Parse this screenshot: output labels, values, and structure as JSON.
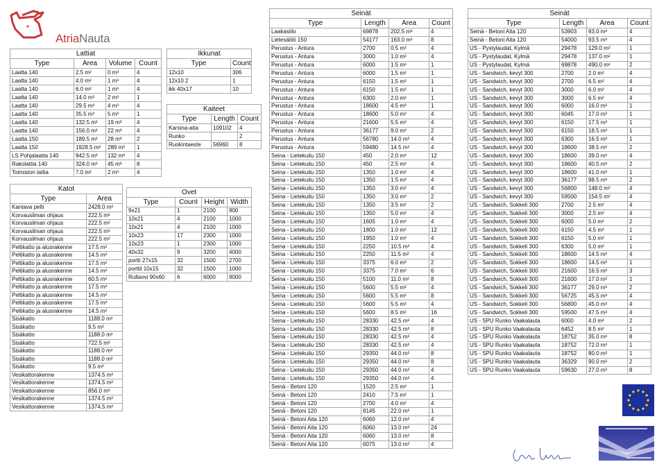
{
  "brand": {
    "name_part1": "Atria",
    "name_part2": "Nauta",
    "accent": "#c8373c",
    "secondary": "#6d6e71"
  },
  "lattiat": {
    "title": "Lattiat",
    "columns": [
      "Type",
      "Area",
      "Volume",
      "Count"
    ],
    "rows": [
      [
        "Laatta 140",
        "2.5 m²",
        "0 m³",
        "4"
      ],
      [
        "Laatta 140",
        "4.0 m²",
        "1 m³",
        "4"
      ],
      [
        "Laatta 140",
        "6.0 m²",
        "1 m³",
        "4"
      ],
      [
        "Laatta 140",
        "14.0 m²",
        "2 m³",
        "1"
      ],
      [
        "Laatta 140",
        "29.5 m²",
        "4 m³",
        "4"
      ],
      [
        "Laatta 140",
        "35.5 m²",
        "5 m³",
        "1"
      ],
      [
        "Laatta 140",
        "132.5 m²",
        "19 m³",
        "4"
      ],
      [
        "Laatta 140",
        "156.0 m²",
        "22 m³",
        "4"
      ],
      [
        "Laatta 150",
        "189.5 m²",
        "28 m³",
        "2"
      ],
      [
        "Laatta 150",
        "1928.5 m²",
        "289 m³",
        "1"
      ],
      [
        "LS Pohjalaatta 140",
        "942.5 m²",
        "132 m³",
        "4"
      ],
      [
        "Rakolattia 140",
        "324.0 m²",
        "45 m³",
        "8"
      ],
      [
        "Toimiston lattia",
        "7.0 m²",
        "2 m³",
        "4"
      ]
    ]
  },
  "ikkunat": {
    "title": "Ikkunat",
    "columns": [
      "Type",
      "Count"
    ],
    "rows": [
      [
        "12x10",
        "306"
      ],
      [
        "12x10 2",
        "1"
      ],
      [
        "ikk 40x17",
        "10"
      ]
    ]
  },
  "kaiteet": {
    "title": "Kaiteet",
    "columns": [
      "Type",
      "Length",
      "Count"
    ],
    "rows": [
      [
        "Karsina-aita",
        "109102",
        "4"
      ],
      [
        "Runko",
        "",
        "2"
      ],
      [
        "Ruokintaeste",
        "56960",
        "8"
      ]
    ]
  },
  "katot": {
    "title": "Katot",
    "columns": [
      "Type",
      "Area"
    ],
    "rows": [
      [
        "Kantava pelti",
        "2428.0 m²"
      ],
      [
        "Korvausilman ohjaus",
        "222.5 m²"
      ],
      [
        "Korvausilman ohjaus",
        "222.5 m²"
      ],
      [
        "Korvausilman ohjaus",
        "222.5 m²"
      ],
      [
        "Korvausilman ohjaus",
        "222.5 m²"
      ],
      [
        "Peltikatto ja alusrakenne",
        "17.5 m²"
      ],
      [
        "Peltikatto ja alusrakenne",
        "14.5 m²"
      ],
      [
        "Peltikatto ja alusrakenne",
        "17.5 m²"
      ],
      [
        "Peltikatto ja alusrakenne",
        "14.5 m²"
      ],
      [
        "Peltikatto ja alusrakenne",
        "60.5 m²"
      ],
      [
        "Peltikatto ja alusrakenne",
        "17.5 m²"
      ],
      [
        "Peltikatto ja alusrakenne",
        "14.5 m²"
      ],
      [
        "Peltikatto ja alusrakenne",
        "17.5 m²"
      ],
      [
        "Peltikatto ja alusrakenne",
        "14.5 m²"
      ],
      [
        "Sisäkatto",
        "1188.0 m²"
      ],
      [
        "Sisäkatto",
        "9.5 m²"
      ],
      [
        "Sisäkatto",
        "1188.0 m²"
      ],
      [
        "Sisäkatto",
        "722.5 m²"
      ],
      [
        "Sisäkatto",
        "1188.0 m²"
      ],
      [
        "Sisäkatto",
        "1188.0 m²"
      ],
      [
        "Sisäkatto",
        "9.5 m²"
      ],
      [
        "Vesikattorakenne",
        "1374.5 m²"
      ],
      [
        "Vesikattorakenne",
        "1374.5 m²"
      ],
      [
        "Vesikattorakenne",
        "856.0 m²"
      ],
      [
        "Vesikattorakenne",
        "1374.5 m²"
      ],
      [
        "Vesikattorakenne",
        "1374.5 m²"
      ]
    ]
  },
  "ovet": {
    "title": "Ovet",
    "columns": [
      "Type",
      "Count",
      "Height",
      "Width"
    ],
    "rows": [
      [
        "9x21",
        "1",
        "2100",
        "900"
      ],
      [
        "10x21",
        "4",
        "2100",
        "1000"
      ],
      [
        "10x21",
        "4",
        "2100",
        "1000"
      ],
      [
        "10x23",
        "17",
        "2300",
        "1000"
      ],
      [
        "10x23",
        "1",
        "2300",
        "1000"
      ],
      [
        "40x32",
        "9",
        "3200",
        "4000"
      ],
      [
        "portti 27x15",
        "32",
        "1500",
        "2700"
      ],
      [
        "porttii 10x15",
        "32",
        "1500",
        "1000"
      ],
      [
        "Rullaovi 90x60",
        "6",
        "6000",
        "9000"
      ]
    ]
  },
  "seinat1": {
    "title": "Seinät",
    "columns": [
      "Type",
      "Length",
      "Area",
      "Count"
    ],
    "rows": [
      [
        "Laakasiilo",
        "69878",
        "202.5 m²",
        "4"
      ],
      [
        "Lietesäiliö 150",
        "54177",
        "163.0 m²",
        "8"
      ],
      [
        "Perustus - Antura",
        "2700",
        "0.5 m²",
        "4"
      ],
      [
        "Perustus - Antura",
        "3000",
        "1.0 m²",
        "4"
      ],
      [
        "Perustus - Antura",
        "6000",
        "1.5 m²",
        "1"
      ],
      [
        "Perustus - Antura",
        "6000",
        "1.5 m²",
        "1"
      ],
      [
        "Perustus - Antura",
        "6150",
        "1.5 m²",
        "1"
      ],
      [
        "Perustus - Antura",
        "6150",
        "1.5 m²",
        "1"
      ],
      [
        "Perustus - Antura",
        "6300",
        "2.0 m²",
        "1"
      ],
      [
        "Perustus - Antura",
        "18600",
        "4.5 m²",
        "1"
      ],
      [
        "Perustus - Antura",
        "18600",
        "5.0 m²",
        "4"
      ],
      [
        "Perustus - Antura",
        "21600",
        "5.5 m²",
        "4"
      ],
      [
        "Perustus - Antura",
        "36177",
        "9.0 m²",
        "2"
      ],
      [
        "Perustus - Antura",
        "56780",
        "14.0 m²",
        "4"
      ],
      [
        "Perustus - Antura",
        "59480",
        "14.5 m²",
        "4"
      ],
      [
        "Seina - Lietekuilu 150",
        "450",
        "2.0 m²",
        "12"
      ],
      [
        "Seina - Lietekuilu 150",
        "450",
        "2.5 m²",
        "4"
      ],
      [
        "Seina - Lietekuilu 150",
        "1350",
        "1.0 m²",
        "4"
      ],
      [
        "Seina - Lietekuilu 150",
        "1350",
        "1.5 m²",
        "4"
      ],
      [
        "Seina - Lietekuilu 150",
        "1350",
        "3.0 m²",
        "4"
      ],
      [
        "Seina - Lietekuilu 150",
        "1350",
        "3.0 m²",
        "2"
      ],
      [
        "Seina - Lietekuilu 150",
        "1350",
        "3.5 m²",
        "2"
      ],
      [
        "Seina - Lietekuilu 150",
        "1350",
        "5.0 m²",
        "4"
      ],
      [
        "Seina - Lietekuilu 150",
        "1605",
        "1.0 m²",
        "4"
      ],
      [
        "Seina - Lietekuilu 150",
        "1800",
        "1.0 m²",
        "12"
      ],
      [
        "Seina - Lietekuilu 150",
        "1950",
        "1.0 m²",
        "4"
      ],
      [
        "Seina - Lietekuilu 150",
        "2250",
        "10.5 m²",
        "4"
      ],
      [
        "Seina - Lietekuilu 150",
        "2250",
        "11.5 m²",
        "4"
      ],
      [
        "Seina - Lietekuilu 150",
        "3375",
        "6.0 m²",
        "2"
      ],
      [
        "Seina - Lietekuilu 150",
        "3375",
        "7.0 m²",
        "6"
      ],
      [
        "Seina - Lietekuilu 150",
        "5100",
        "11.0 m²",
        "8"
      ],
      [
        "Seina - Lietekuilu 150",
        "5600",
        "5.5 m²",
        "4"
      ],
      [
        "Seina - Lietekuilu 150",
        "5600",
        "5.5 m²",
        "8"
      ],
      [
        "Seina - Lietekuilu 150",
        "5600",
        "5.5 m²",
        "4"
      ],
      [
        "Seina - Lietekuilu 150",
        "5600",
        "8.5 m²",
        "16"
      ],
      [
        "Seina - Lietekuilu 150",
        "28330",
        "42.5 m²",
        "4"
      ],
      [
        "Seina - Lietekuilu 150",
        "28330",
        "42.5 m²",
        "8"
      ],
      [
        "Seina - Lietekuilu 150",
        "28330",
        "42.5 m²",
        "4"
      ],
      [
        "Seina - Lietekuilu 150",
        "28330",
        "42.5 m²",
        "4"
      ],
      [
        "Seina - Lietekuilu 150",
        "29350",
        "44.0 m²",
        "8"
      ],
      [
        "Seina - Lietekuilu 150",
        "29350",
        "44.0 m²",
        "8"
      ],
      [
        "Seina - Lietekuilu 150",
        "29350",
        "44.0 m²",
        "4"
      ],
      [
        "Seina - Lietekuilu 150",
        "29350",
        "44.0 m²",
        "4"
      ],
      [
        "Seinä - Betoni 120",
        "1520",
        "2.5 m²",
        "1"
      ],
      [
        "Seinä - Betoni 120",
        "2410",
        "7.5 m²",
        "1"
      ],
      [
        "Seinä - Betoni 120",
        "2700",
        "4.0 m²",
        "4"
      ],
      [
        "Seinä - Betoni 120",
        "8145",
        "22.0 m²",
        "1"
      ],
      [
        "Seinä - Betoni Aita 120",
        "6060",
        "12.0 m²",
        "4"
      ],
      [
        "Seinä - Betoni Aita 120",
        "6060",
        "13.0 m²",
        "24"
      ],
      [
        "Seinä - Betoni Aita 120",
        "6060",
        "13.0 m²",
        "8"
      ],
      [
        "Seinä - Betoni Aita 120",
        "6075",
        "13.0 m²",
        "4"
      ]
    ]
  },
  "seinat2": {
    "title": "Seinät",
    "columns": [
      "Type",
      "Length",
      "Area",
      "Count"
    ],
    "rows": [
      [
        "Seinä - Betoni Aita 120",
        "53903",
        "93.0 m²",
        "4"
      ],
      [
        "Seinä - Betoni Aita 120",
        "54000",
        "93.5 m²",
        "4"
      ],
      [
        "US - Pystylaudat, Kylmä",
        "29478",
        "129.0 m²",
        "1"
      ],
      [
        "US - Pystylaudat, Kylmä",
        "29478",
        "137.0 m²",
        "1"
      ],
      [
        "US - Pystylaudat, Kylmä",
        "69878",
        "490.0 m²",
        "2"
      ],
      [
        "US - Sandwich, kevyt 300",
        "2700",
        "2.0 m²",
        "4"
      ],
      [
        "US - Sandwich, kevyt 300",
        "2700",
        "6.5 m²",
        "4"
      ],
      [
        "US - Sandwich, kevyt 300",
        "3000",
        "6.0 m²",
        "4"
      ],
      [
        "US - Sandwich, kevyt 300",
        "3000",
        "6.5 m²",
        "4"
      ],
      [
        "US - Sandwich, kevyt 300",
        "6000",
        "16.0 m²",
        "1"
      ],
      [
        "US - Sandwich, kevyt 300",
        "6045",
        "17.0 m²",
        "1"
      ],
      [
        "US - Sandwich, kevyt 300",
        "6150",
        "17.5 m²",
        "1"
      ],
      [
        "US - Sandwich, kevyt 300",
        "6150",
        "18.5 m²",
        "1"
      ],
      [
        "US - Sandwich, kevyt 300",
        "6300",
        "16.5 m²",
        "1"
      ],
      [
        "US - Sandwich, kevyt 300",
        "18600",
        "38.5 m²",
        "2"
      ],
      [
        "US - Sandwich, kevyt 300",
        "18600",
        "39.0 m²",
        "4"
      ],
      [
        "US - Sandwich, kevyt 300",
        "18600",
        "40.5 m²",
        "2"
      ],
      [
        "US - Sandwich, kevyt 300",
        "18600",
        "41.0 m²",
        "1"
      ],
      [
        "US - Sandwich, kevyt 300",
        "36177",
        "98.5 m²",
        "2"
      ],
      [
        "US - Sandwich, kevyt 300",
        "56800",
        "148.0 m²",
        "4"
      ],
      [
        "US - Sandwich, kevyt 300",
        "59500",
        "154.5 m²",
        "4"
      ],
      [
        "US - Sandwich, Sokkeli 300",
        "2700",
        "2.5 m²",
        "4"
      ],
      [
        "US - Sandwich, Sokkeli 300",
        "3000",
        "2.5 m²",
        "4"
      ],
      [
        "US - Sandwich, Sokkeli 300",
        "6000",
        "5.0 m²",
        "2"
      ],
      [
        "US - Sandwich, Sokkeli 300",
        "6150",
        "4.5 m²",
        "1"
      ],
      [
        "US - Sandwich, Sokkeli 300",
        "6150",
        "5.0 m²",
        "1"
      ],
      [
        "US - Sandwich, Sokkeli 300",
        "6300",
        "5.0 m²",
        "1"
      ],
      [
        "US - Sandwich, Sokkeli 300",
        "18600",
        "14.5 m²",
        "4"
      ],
      [
        "US - Sandwich, Sokkeli 300",
        "18600",
        "14.5 m²",
        "1"
      ],
      [
        "US - Sandwich, Sokkeli 300",
        "21600",
        "16.5 m²",
        "3"
      ],
      [
        "US - Sandwich, Sokkeli 300",
        "21600",
        "17.0 m²",
        "1"
      ],
      [
        "US - Sandwich, Sokkeli 300",
        "36177",
        "29.0 m²",
        "2"
      ],
      [
        "US - Sandwich, Sokkeli 300",
        "56725",
        "45.5 m²",
        "4"
      ],
      [
        "US - Sandwich, Sokkeli 300",
        "56800",
        "45.0 m²",
        "4"
      ],
      [
        "US - Sandwich, Sokkeli 300",
        "59500",
        "47.5 m²",
        "4"
      ],
      [
        "US - SPU Runko Vaakalauta",
        "6000",
        "4.0 m²",
        "2"
      ],
      [
        "US - SPU Runko Vaakalauta",
        "6452",
        "8.5 m²",
        "1"
      ],
      [
        "US - SPU Runko Vaakalauta",
        "18752",
        "35.0 m²",
        "8"
      ],
      [
        "US - SPU Runko Vaakalauta",
        "18752",
        "72.0 m²",
        "1"
      ],
      [
        "US - SPU Runko Vaakalauta",
        "18752",
        "80.0 m²",
        "1"
      ],
      [
        "US - SPU Runko Vaakalauta",
        "36329",
        "90.0 m²",
        "2"
      ],
      [
        "US - SPU Runko Vaakalauta",
        "59630",
        "27.0 m²",
        "8"
      ]
    ]
  },
  "icons": {
    "logo": "bull-head-logo",
    "eu_flag": "eu-flag-icon",
    "banner": "farm-design-banner",
    "signature": "handwritten-signature"
  }
}
